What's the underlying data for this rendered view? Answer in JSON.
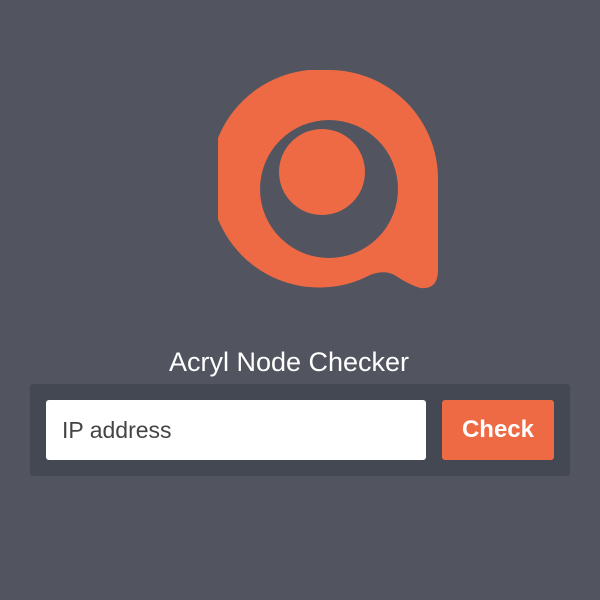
{
  "app": {
    "title": "Acryl Node Checker",
    "logo_icon": "acryl-logo-icon",
    "brand_color": "#ee6a45",
    "background_color": "#52555f"
  },
  "form": {
    "ip_placeholder": "IP address",
    "ip_value": "",
    "check_label": "Check"
  }
}
